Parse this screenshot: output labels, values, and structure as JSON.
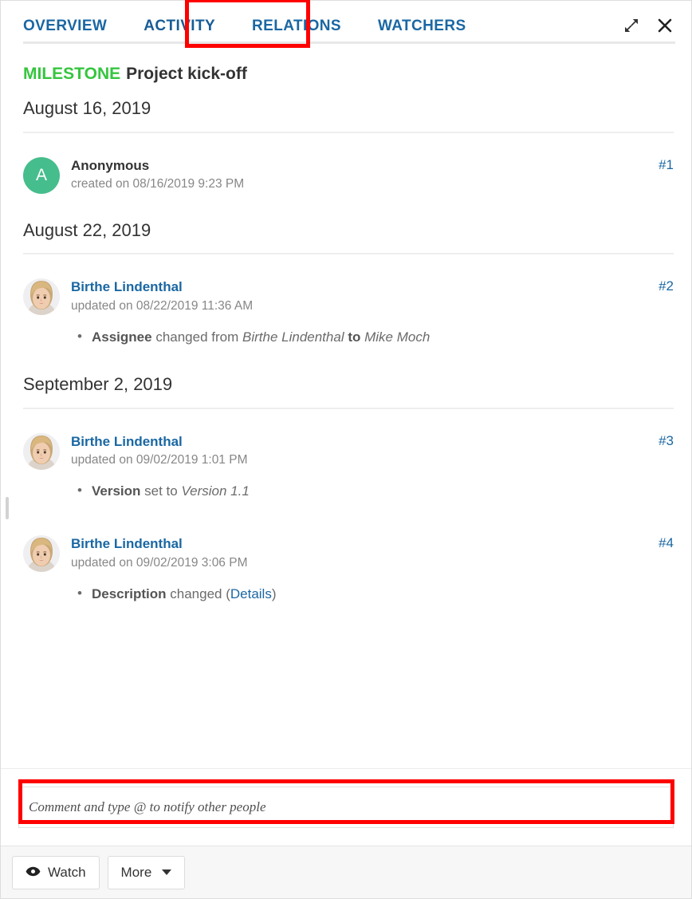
{
  "header": {
    "tabs": [
      {
        "label": "OVERVIEW",
        "active": false
      },
      {
        "label": "ACTIVITY",
        "active": true
      },
      {
        "label": "RELATIONS",
        "active": false
      },
      {
        "label": "WATCHERS",
        "active": false
      }
    ],
    "expand_icon": "expand-diagonal-arrows-icon",
    "close_icon": "close-x-icon"
  },
  "work_package": {
    "type": "MILESTONE",
    "type_color": "#35c53f",
    "subject": "Project kick-off"
  },
  "groups": [
    {
      "date": "August 16, 2019",
      "entries": [
        {
          "avatar_kind": "initials",
          "avatar_initial": "A",
          "avatar_color": "#46bd8c",
          "user": "Anonymous",
          "user_is_link": false,
          "time": "created on 08/16/2019 9:23 PM",
          "number": "#1",
          "details": []
        }
      ]
    },
    {
      "date": "August 22, 2019",
      "entries": [
        {
          "avatar_kind": "photo",
          "user": "Birthe Lindenthal",
          "user_is_link": true,
          "time": "updated on 08/22/2019 11:36 AM",
          "number": "#2",
          "details": [
            {
              "parts": [
                {
                  "text": "Assignee",
                  "style": "bold"
                },
                {
                  "text": " changed from ",
                  "style": "plain"
                },
                {
                  "text": "Birthe Lindenthal",
                  "style": "italic"
                },
                {
                  "text": " ",
                  "style": "plain"
                },
                {
                  "text": "to",
                  "style": "bold"
                },
                {
                  "text": " ",
                  "style": "plain"
                },
                {
                  "text": "Mike Moch",
                  "style": "italic"
                }
              ]
            }
          ]
        }
      ]
    },
    {
      "date": "September 2, 2019",
      "entries": [
        {
          "avatar_kind": "photo",
          "user": "Birthe Lindenthal",
          "user_is_link": true,
          "time": "updated on 09/02/2019 1:01 PM",
          "number": "#3",
          "details": [
            {
              "parts": [
                {
                  "text": "Version",
                  "style": "bold"
                },
                {
                  "text": " set to ",
                  "style": "plain"
                },
                {
                  "text": "Version 1.1",
                  "style": "italic"
                }
              ]
            }
          ]
        },
        {
          "avatar_kind": "photo",
          "user": "Birthe Lindenthal",
          "user_is_link": true,
          "time": "updated on 09/02/2019 3:06 PM",
          "number": "#4",
          "details": [
            {
              "parts": [
                {
                  "text": "Description",
                  "style": "bold"
                },
                {
                  "text": " changed (",
                  "style": "plain"
                },
                {
                  "text": "Details",
                  "style": "link"
                },
                {
                  "text": ")",
                  "style": "plain"
                }
              ]
            }
          ]
        }
      ]
    }
  ],
  "comment": {
    "placeholder": "Comment and type @ to notify other people",
    "value": ""
  },
  "footer": {
    "watch_label": "Watch",
    "watch_icon": "eye-icon",
    "more_label": "More",
    "more_icon": "caret-down-icon"
  },
  "annotations": {
    "color": "#ff0000",
    "targets": [
      "tab-activity",
      "comment-input"
    ]
  }
}
